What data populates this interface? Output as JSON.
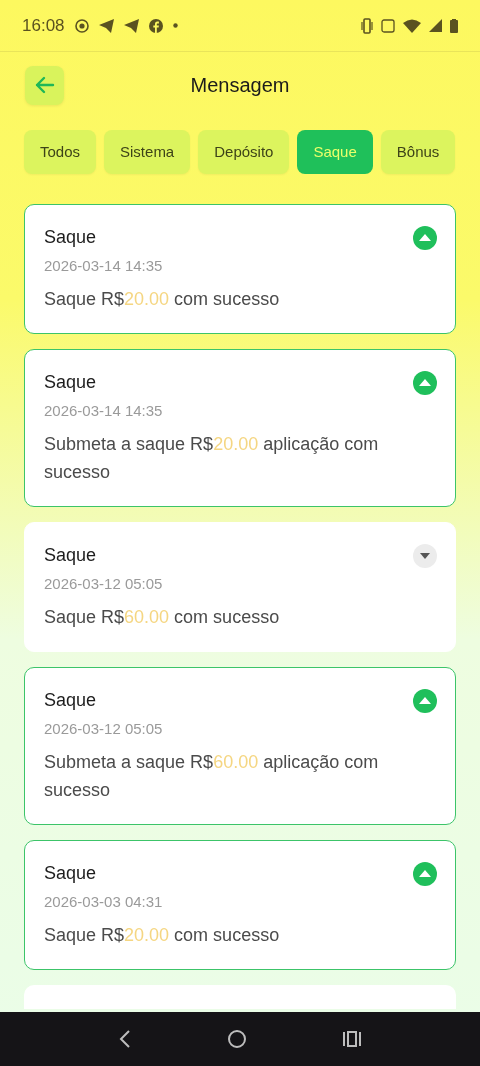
{
  "status_bar": {
    "time": "16:08"
  },
  "header": {
    "title": "Mensagem"
  },
  "tabs": [
    {
      "label": "Todos",
      "selected": false
    },
    {
      "label": "Sistema",
      "selected": false
    },
    {
      "label": "Depósito",
      "selected": false
    },
    {
      "label": "Saque",
      "selected": true
    },
    {
      "label": "Bônus",
      "selected": false
    }
  ],
  "messages": [
    {
      "title": "Saque",
      "date": "2026-03-14 14:35",
      "before": "Saque R$",
      "amount": "20.00",
      "after": " com sucesso",
      "unread": true
    },
    {
      "title": "Saque",
      "date": "2026-03-14 14:35",
      "before": "Submeta a saque R$",
      "amount": "20.00",
      "after": " aplicação com sucesso",
      "unread": true
    },
    {
      "title": "Saque",
      "date": "2026-03-12 05:05",
      "before": "Saque R$",
      "amount": "60.00",
      "after": " com sucesso",
      "unread": false
    },
    {
      "title": "Saque",
      "date": "2026-03-12 05:05",
      "before": "Submeta a saque R$",
      "amount": "60.00",
      "after": " aplicação com sucesso",
      "unread": true
    },
    {
      "title": "Saque",
      "date": "2026-03-03 04:31",
      "before": "Saque R$",
      "amount": "20.00",
      "after": " com sucesso",
      "unread": true
    }
  ],
  "more_below": true
}
